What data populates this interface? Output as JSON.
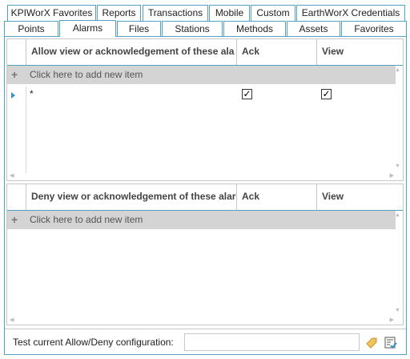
{
  "tabs_row1": [
    {
      "label": "KPIWorX Favorites"
    },
    {
      "label": "Reports"
    },
    {
      "label": "Transactions"
    },
    {
      "label": "Mobile"
    },
    {
      "label": "Custom"
    },
    {
      "label": "EarthWorX Credentials"
    }
  ],
  "tabs_row2": [
    {
      "label": "Points"
    },
    {
      "label": "Alarms",
      "active": true
    },
    {
      "label": "Files"
    },
    {
      "label": "Stations"
    },
    {
      "label": "Methods"
    },
    {
      "label": "Assets"
    },
    {
      "label": "Favorites"
    }
  ],
  "allow_grid": {
    "columns": [
      "Allow view or acknowledgement of these ala",
      "Ack",
      "View"
    ],
    "add_row_label": "Click here to add new item",
    "rows": [
      {
        "pattern": "*",
        "ack": true,
        "view": true
      }
    ]
  },
  "deny_grid": {
    "columns": [
      "Deny view or acknowledgement of these alar",
      "Ack",
      "View"
    ],
    "add_row_label": "Click here to add new item",
    "rows": []
  },
  "footer": {
    "test_label": "Test current Allow/Deny configuration:",
    "test_value": "",
    "icons": [
      "tag-icon",
      "test-config-icon"
    ]
  },
  "colors": {
    "tab_border": "#4fa3c0",
    "add_row_bg": "#d4d4d4",
    "row_indicator": "#3a8fd0"
  }
}
